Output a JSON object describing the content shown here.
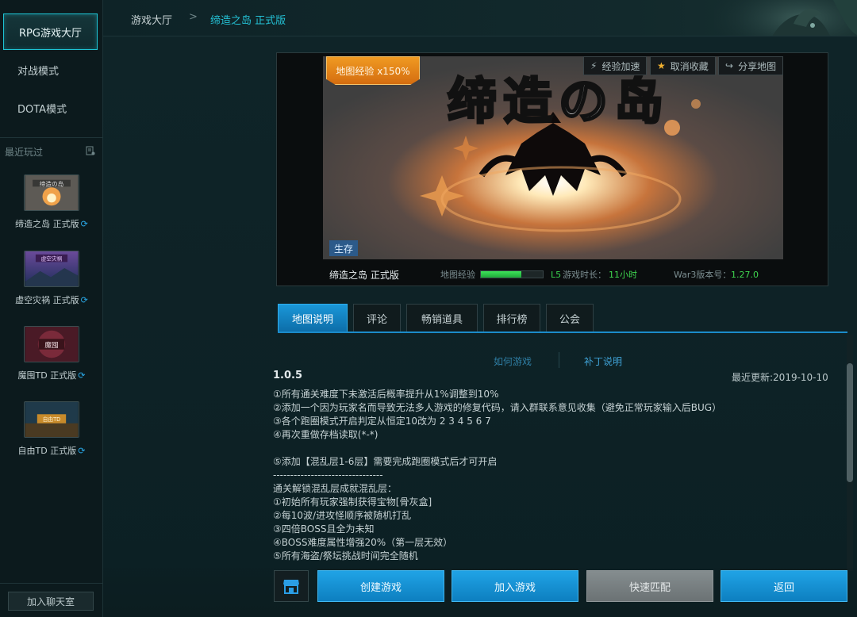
{
  "sidebar": {
    "modes": [
      "RPG游戏大厅",
      "对战模式",
      "DOTA模式"
    ],
    "recent_label": "最近玩过",
    "recent_games": [
      {
        "name": "缔造之岛 正式版"
      },
      {
        "name": "虚空灾祸 正式版"
      },
      {
        "name": "魔囤TD 正式版"
      },
      {
        "name": "自由TD 正式版"
      }
    ],
    "chat_button": "加入聊天室"
  },
  "header": {
    "crumb_home": "游戏大厅",
    "crumb_sep": ">",
    "crumb_current": "缔造之岛 正式版"
  },
  "banner": {
    "exp_ribbon": "地图经验 x150%",
    "boost_label": "经验加速",
    "unfavorite_label": "取消收藏",
    "share_label": "分享地图",
    "survival_tag": "生存",
    "art_title": "缔造の岛",
    "map_name": "缔造之岛 正式版",
    "exp_label": "地图经验",
    "exp_progress": 0.65,
    "level": "L5",
    "play_time_label": "游戏时长：",
    "play_time": "11小时",
    "war3_version_label": "War3版本号：",
    "war3_version": "1.27.0"
  },
  "tabs": [
    "地图说明",
    "评论",
    "畅销道具",
    "排行榜",
    "公会"
  ],
  "sublinks": [
    "如何游戏",
    "补丁说明"
  ],
  "description": {
    "version": "1.0.5",
    "updated": "最近更新:2019-10-10",
    "lines": [
      "①所有通关难度下未激活后概率提升从1%调整到10%",
      "②添加一个因为玩家名而导致无法多人游戏的修复代码，请入群联系意见收集（避免正常玩家输入后BUG）",
      "③各个跑圈模式开启判定从恒定10改为 2 3 4 5 6 7",
      "④再次重做存档读取(*-*)",
      "",
      "⑤添加【混乱层1-6层】需要完成跑圈模式后才可开启",
      "--------------------------------",
      "通关解锁混乱层成就混乱层：",
      "①初始所有玩家强制获得宝物[骨灰盒]",
      "②每10波/进攻怪顺序被随机打乱",
      "③四倍BOSS且全为未知",
      "④BOSS难度属性增强20%（第一层无效）",
      "⑤所有海盗/祭坛挑战时间完全随机"
    ]
  },
  "actions": {
    "create": "创建游戏",
    "join": "加入游戏",
    "quick_match": "快速匹配",
    "back": "返回"
  },
  "colors": {
    "accent": "#1ec4d4",
    "primary_button": "#1a97d8",
    "exp_green": "#3fd64f",
    "ribbon_orange": "#e98318"
  }
}
